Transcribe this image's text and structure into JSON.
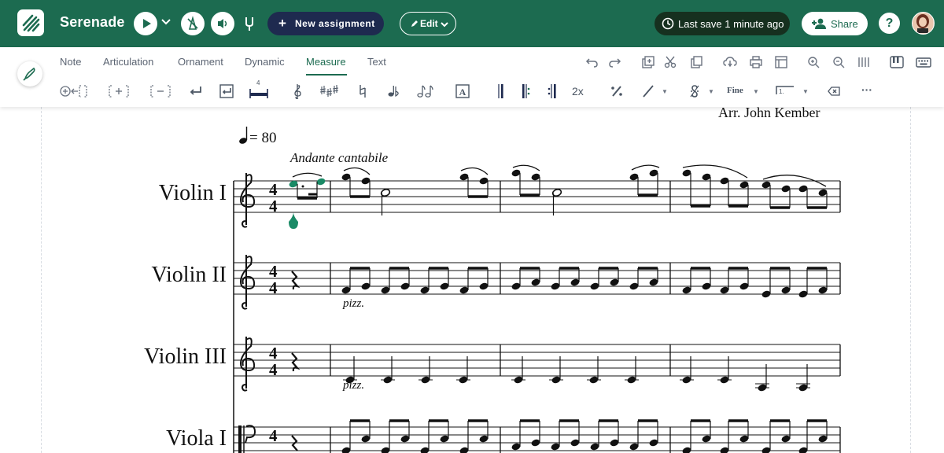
{
  "app": {
    "title": "Serenade",
    "new_assignment_label": "New assignment",
    "edit_label": "Edit",
    "save_status": "Last save 1 minute ago",
    "share_label": "Share",
    "help_label": "?"
  },
  "colors": {
    "brand_green": "#1c6b50",
    "navy": "#1e2a4f",
    "selected_note": "#1a8a66"
  },
  "tabs": [
    {
      "label": "Note"
    },
    {
      "label": "Articulation"
    },
    {
      "label": "Ornament"
    },
    {
      "label": "Dynamic"
    },
    {
      "label": "Measure",
      "active": true
    },
    {
      "label": "Text"
    }
  ],
  "toolbar_text": {
    "repeat_count": "2x",
    "fine": "Fine",
    "ending_number": "1.",
    "more": "···",
    "text_box_glyph": "A",
    "time_sig_small": "4"
  },
  "score": {
    "arranger": "Arr. John Kember",
    "tempo_value": "= 80",
    "expression": "Andante cantabile",
    "instruments": [
      {
        "name": "Violin I"
      },
      {
        "name": "Violin II",
        "technique": "pizz."
      },
      {
        "name": "Violin III",
        "technique": "pizz."
      },
      {
        "name": "Viola I"
      }
    ],
    "time_signature": "4/4"
  }
}
